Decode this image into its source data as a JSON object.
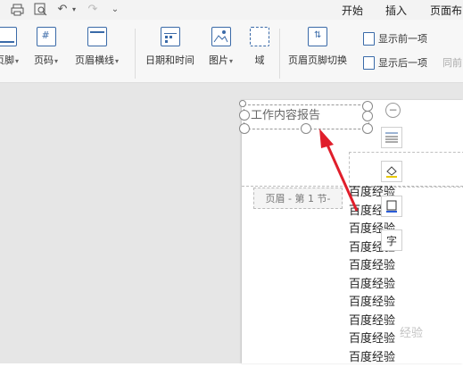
{
  "menu": {
    "tabs": [
      "开始",
      "插入",
      "页面布"
    ]
  },
  "ribbon": {
    "buttons": [
      {
        "label": "页脚",
        "dropdown": true,
        "icon": "footer-icon"
      },
      {
        "label": "页码",
        "dropdown": true,
        "icon": "page-number-icon"
      },
      {
        "label": "页眉横线",
        "dropdown": true,
        "icon": "header-line-icon"
      },
      {
        "label": "日期和时间",
        "dropdown": false,
        "icon": "date-time-icon"
      },
      {
        "label": "图片",
        "dropdown": true,
        "icon": "picture-icon"
      },
      {
        "label": "域",
        "dropdown": false,
        "icon": "field-icon"
      },
      {
        "label": "页眉页脚切换",
        "dropdown": false,
        "icon": "header-footer-switch-icon"
      }
    ],
    "small_buttons": [
      {
        "label": "显示前一项",
        "icon": "show-previous-icon"
      },
      {
        "label": "显示后一项",
        "icon": "show-next-icon"
      }
    ],
    "cut_label": "同前"
  },
  "document": {
    "header_text": "工作内容报告",
    "header_label": "页眉 - 第 1 节-",
    "body_lines": [
      "百度经验",
      "百度经验",
      "百度经验",
      "百度经验",
      "百度经验",
      "百度经验",
      "百度经验",
      "百度经验",
      "百度经验",
      "百度经验"
    ],
    "tool_char": "字",
    "watermark": "经验"
  },
  "colors": {
    "accent": "#3a6aa8",
    "arrow": "#e01e2b"
  }
}
